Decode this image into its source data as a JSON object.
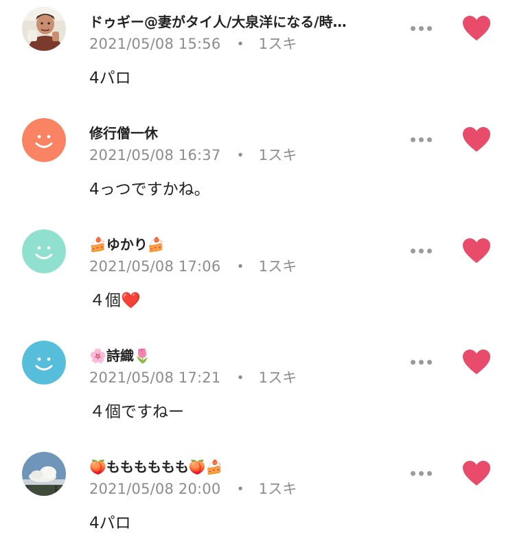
{
  "colors": {
    "heart": "#e94c6a",
    "meta_text": "#8c8c8c",
    "avatar_orange": "#fa8363",
    "avatar_mint": "#8fe0cf",
    "avatar_blue": "#56bedb"
  },
  "comments": [
    {
      "avatar": "photo-man-avatar",
      "name": "ドゥギー@妻がタイ人/大泉洋になる/時…",
      "date": "2021/05/08 15:56",
      "separator": "・",
      "likes": "1スキ",
      "text": "4パロ"
    },
    {
      "avatar": "orange-smile-avatar",
      "name": "修行僧一休",
      "date": "2021/05/08 16:37",
      "separator": "・",
      "likes": "1スキ",
      "text": "4っつですかね。"
    },
    {
      "avatar": "mint-smile-avatar",
      "name": "🍰ゆかり🍰",
      "date": "2021/05/08 17:06",
      "separator": "・",
      "likes": "1スキ",
      "text": "４個❤️"
    },
    {
      "avatar": "blue-smile-avatar",
      "name": "🌸詩織🌷",
      "date": "2021/05/08 17:21",
      "separator": "・",
      "likes": "1スキ",
      "text": "４個ですねー"
    },
    {
      "avatar": "sky-cloud-avatar",
      "name": "🍑もももももも🍑🍰",
      "date": "2021/05/08 20:00",
      "separator": "・",
      "likes": "1スキ",
      "text": "4パロ"
    }
  ]
}
